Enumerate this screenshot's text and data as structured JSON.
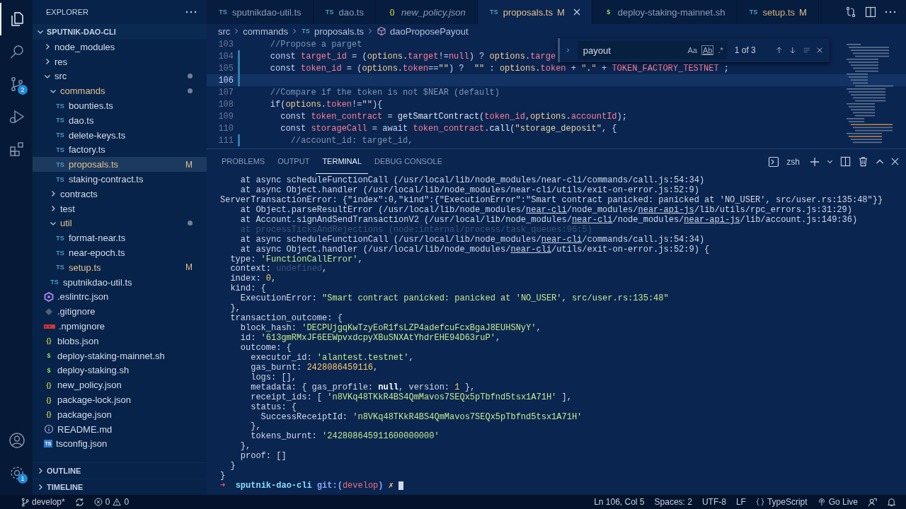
{
  "activity_bar": {
    "items": [
      {
        "kind": "explorer",
        "selected": true
      },
      {
        "kind": "search",
        "selected": false
      },
      {
        "kind": "source-control",
        "selected": false,
        "badge": "2"
      },
      {
        "kind": "run",
        "selected": false
      },
      {
        "kind": "extensions",
        "selected": false
      }
    ],
    "bottom": [
      {
        "kind": "account"
      },
      {
        "kind": "settings",
        "badge": "1"
      }
    ]
  },
  "sidebar": {
    "title": "EXPLORER",
    "root": {
      "label": "SPUTNIK-DAO-CLI",
      "expanded": true
    },
    "items": [
      {
        "label": "node_modules",
        "kind": "folder",
        "expanded": false,
        "has_changes": false,
        "modified": false
      },
      {
        "label": "res",
        "kind": "folder",
        "expanded": false,
        "has_changes": false,
        "modified": false
      },
      {
        "label": "src",
        "kind": "folder",
        "expanded": true,
        "has_changes": true,
        "modified": false,
        "children": [
          {
            "label": "commands",
            "kind": "folder",
            "expanded": true,
            "has_changes": true,
            "modified": true,
            "children": [
              {
                "label": "bounties.ts",
                "kind": "ts",
                "icon_text": "TS",
                "selected": false,
                "modified": false
              },
              {
                "label": "dao.ts",
                "kind": "ts",
                "icon_text": "TS",
                "selected": false,
                "modified": false
              },
              {
                "label": "delete-keys.ts",
                "kind": "ts",
                "icon_text": "TS",
                "selected": false,
                "modified": false
              },
              {
                "label": "factory.ts",
                "kind": "ts",
                "icon_text": "TS",
                "selected": false,
                "modified": false
              },
              {
                "label": "proposals.ts",
                "kind": "ts",
                "icon_text": "TS",
                "selected": true,
                "modified": true,
                "status": "M"
              },
              {
                "label": "staking-contract.ts",
                "kind": "ts",
                "icon_text": "TS",
                "selected": false,
                "modified": false
              }
            ]
          },
          {
            "label": "contracts",
            "kind": "folder",
            "expanded": false,
            "has_changes": false,
            "modified": false
          },
          {
            "label": "test",
            "kind": "folder",
            "expanded": false,
            "has_changes": false,
            "modified": false
          },
          {
            "label": "util",
            "kind": "folder",
            "expanded": true,
            "has_changes": true,
            "modified": true,
            "children": [
              {
                "label": "format-near.ts",
                "kind": "ts",
                "icon_text": "TS",
                "selected": false,
                "modified": false
              },
              {
                "label": "near-epoch.ts",
                "kind": "ts",
                "icon_text": "TS",
                "selected": false,
                "modified": false
              },
              {
                "label": "setup.ts",
                "kind": "ts",
                "icon_text": "TS",
                "selected": false,
                "modified": true,
                "status": "M"
              }
            ]
          },
          {
            "label": "sputnikdao-util.ts",
            "kind": "ts",
            "icon_text": "TS",
            "selected": false,
            "modified": false
          }
        ]
      },
      {
        "label": ".eslintrc.json",
        "kind": "eslint",
        "selected": false,
        "modified": false
      },
      {
        "label": ".gitignore",
        "kind": "git",
        "selected": false,
        "modified": false
      },
      {
        "label": ".npmignore",
        "kind": "npm",
        "selected": false,
        "modified": false
      },
      {
        "label": "blobs.json",
        "kind": "json",
        "icon_text": "{}",
        "selected": false,
        "modified": false
      },
      {
        "label": "deploy-staking-mainnet.sh",
        "kind": "sh",
        "icon_text": "$",
        "selected": false,
        "modified": false
      },
      {
        "label": "deploy-staking.sh",
        "kind": "sh",
        "icon_text": "$",
        "selected": false,
        "modified": false
      },
      {
        "label": "new_policy.json",
        "kind": "json",
        "icon_text": "{}",
        "selected": false,
        "modified": false
      },
      {
        "label": "package-lock.json",
        "kind": "json",
        "icon_text": "{}",
        "selected": false,
        "modified": false
      },
      {
        "label": "package.json",
        "kind": "json",
        "icon_text": "{}",
        "selected": false,
        "modified": false
      },
      {
        "label": "README.md",
        "kind": "info",
        "selected": false,
        "modified": false
      },
      {
        "label": "tsconfig.json",
        "kind": "tsconfig",
        "icon_text": "TS",
        "selected": false,
        "modified": false
      }
    ],
    "sections": [
      {
        "label": "OUTLINE",
        "expanded": false
      },
      {
        "label": "TIMELINE",
        "expanded": false
      }
    ]
  },
  "tabs": [
    {
      "label": "sputnikdao-util.ts",
      "kind": "ts",
      "icon_text": "TS",
      "selected": false,
      "preview": false,
      "modified": false
    },
    {
      "label": "dao.ts",
      "kind": "ts",
      "icon_text": "TS",
      "selected": false,
      "preview": false,
      "modified": false
    },
    {
      "label": "new_policy.json",
      "kind": "json",
      "icon_text": "{}",
      "selected": false,
      "preview": true,
      "modified": false
    },
    {
      "label": "proposals.ts",
      "kind": "ts",
      "icon_text": "TS",
      "selected": true,
      "preview": false,
      "modified": true,
      "status": "M"
    },
    {
      "label": "deploy-staking-mainnet.sh",
      "kind": "sh",
      "icon_text": "$",
      "selected": false,
      "preview": false,
      "modified": false
    },
    {
      "label": "setup.ts",
      "kind": "ts",
      "icon_text": "TS",
      "selected": false,
      "preview": false,
      "modified": true,
      "status": "M"
    }
  ],
  "breadcrumbs": [
    {
      "label": "src",
      "kind": "folder"
    },
    {
      "label": "commands",
      "kind": "folder"
    },
    {
      "label": "proposals.ts",
      "kind": "ts",
      "icon_text": "TS"
    },
    {
      "label": "daoProposePayout",
      "kind": "symbol"
    }
  ],
  "editor": {
    "lines": [
      {
        "num": "103",
        "changed": false,
        "current": false,
        "segments": [
          {
            "kind": "cmt",
            "text": "    //Propose a parget"
          }
        ]
      },
      {
        "num": "104",
        "changed": true,
        "current": false,
        "segments": [
          {
            "kind": "kw",
            "text": "    const "
          },
          {
            "kind": "id",
            "text": "target_id"
          },
          {
            "kind": "op",
            "text": " = ("
          },
          {
            "kind": "obj",
            "text": "options"
          },
          {
            "kind": "op",
            "text": "."
          },
          {
            "kind": "id",
            "text": "target"
          },
          {
            "kind": "op",
            "text": "!="
          },
          {
            "kind": "id",
            "text": "null"
          },
          {
            "kind": "op",
            "text": ") ? "
          },
          {
            "kind": "obj",
            "text": "options"
          },
          {
            "kind": "op",
            "text": "."
          },
          {
            "kind": "id",
            "text": "targe"
          }
        ]
      },
      {
        "num": "105",
        "changed": true,
        "current": false,
        "segments": [
          {
            "kind": "kw",
            "text": "    const "
          },
          {
            "kind": "id",
            "text": "token_id"
          },
          {
            "kind": "op",
            "text": " = ("
          },
          {
            "kind": "obj",
            "text": "options"
          },
          {
            "kind": "op",
            "text": "."
          },
          {
            "kind": "id",
            "text": "token"
          },
          {
            "kind": "op",
            "text": "=="
          },
          {
            "kind": "str",
            "text": "\"\""
          },
          {
            "kind": "op",
            "text": ") ?  "
          },
          {
            "kind": "str",
            "text": "\"\""
          },
          {
            "kind": "op",
            "text": " : "
          },
          {
            "kind": "obj",
            "text": "options"
          },
          {
            "kind": "op",
            "text": "."
          },
          {
            "kind": "id",
            "text": "token"
          },
          {
            "kind": "op",
            "text": " + "
          },
          {
            "kind": "str",
            "text": "\".\""
          },
          {
            "kind": "op",
            "text": " + "
          },
          {
            "kind": "id",
            "text": "TOKEN_FACTORY_TESTNET"
          },
          {
            "kind": "op",
            "text": " ;"
          }
        ]
      },
      {
        "num": "106",
        "changed": true,
        "current": true
      },
      {
        "num": "107",
        "changed": false,
        "current": false,
        "segments": [
          {
            "kind": "cmt",
            "text": "    //Compare if the token is not $NEAR (default)"
          }
        ]
      },
      {
        "num": "108",
        "changed": false,
        "current": false,
        "segments": [
          {
            "kind": "kw",
            "text": "    if"
          },
          {
            "kind": "op",
            "text": "("
          },
          {
            "kind": "obj",
            "text": "options"
          },
          {
            "kind": "op",
            "text": "."
          },
          {
            "kind": "id",
            "text": "token"
          },
          {
            "kind": "op",
            "text": "!="
          },
          {
            "kind": "str",
            "text": "\"\""
          },
          {
            "kind": "op",
            "text": "){"
          }
        ]
      },
      {
        "num": "109",
        "changed": false,
        "current": false,
        "segments": [
          {
            "kind": "kw",
            "text": "      const "
          },
          {
            "kind": "id",
            "text": "token_contract"
          },
          {
            "kind": "op",
            "text": " = "
          },
          {
            "kind": "fn",
            "text": "getSmartContract"
          },
          {
            "kind": "op",
            "text": "("
          },
          {
            "kind": "id",
            "text": "token_id"
          },
          {
            "kind": "op",
            "text": ","
          },
          {
            "kind": "obj",
            "text": "options"
          },
          {
            "kind": "op",
            "text": "."
          },
          {
            "kind": "id",
            "text": "accountId"
          },
          {
            "kind": "op",
            "text": ");"
          }
        ]
      },
      {
        "num": "110",
        "changed": false,
        "current": false,
        "segments": [
          {
            "kind": "kw",
            "text": "      const "
          },
          {
            "kind": "id",
            "text": "storageCall"
          },
          {
            "kind": "op",
            "text": " = "
          },
          {
            "kind": "kw",
            "text": "await "
          },
          {
            "kind": "id",
            "text": "token_contract"
          },
          {
            "kind": "op",
            "text": "."
          },
          {
            "kind": "fn",
            "text": "call"
          },
          {
            "kind": "op",
            "text": "("
          },
          {
            "kind": "str",
            "text": "\"storage_deposit\""
          },
          {
            "kind": "op",
            "text": ", {"
          }
        ]
      },
      {
        "num": "111",
        "changed": true,
        "current": false,
        "segments": [
          {
            "kind": "cmt",
            "text": "        //account_id: target_id,"
          }
        ]
      }
    ],
    "find": {
      "value": "payout",
      "options": [
        "Aa",
        "Ab",
        ".*"
      ],
      "result": "1 of 3"
    }
  },
  "panel": {
    "tabs": [
      {
        "label": "PROBLEMS",
        "selected": false
      },
      {
        "label": "OUTPUT",
        "selected": false
      },
      {
        "label": "TERMINAL",
        "selected": true
      },
      {
        "label": "DEBUG CONSOLE",
        "selected": false
      }
    ],
    "shell": "zsh",
    "cursor": true,
    "lines": [
      [
        {
          "kind": "p",
          "text": "    at async scheduleFunctionCall (/usr/local/lib/node_modules/near-cli/commands/call.js:54:34)"
        }
      ],
      [
        {
          "kind": "p",
          "text": "    at async Object.handler (/usr/local/lib/node_modules/near-cli/utils/exit-on-error.js:52:9)"
        }
      ],
      [
        {
          "kind": "p",
          "text": "ServerTransactionError: {\"index\":0,\"kind\":{\"ExecutionError\":\"Smart contract panicked: panicked at 'NO_USER', src/user.rs:135:48\"}}"
        }
      ],
      [
        {
          "kind": "p",
          "text": "    at Object.parseResultError (/usr/local/lib/node_modules/"
        },
        {
          "kind": "link",
          "text": "near-cli"
        },
        {
          "kind": "p",
          "text": "/node_modules/"
        },
        {
          "kind": "link",
          "text": "near-api-js"
        },
        {
          "kind": "p",
          "text": "/lib/utils/rpc_errors.js:31:29)"
        }
      ],
      [
        {
          "kind": "p",
          "text": "    at Account.signAndSendTransactionV2 (/usr/local/lib/node_modules/"
        },
        {
          "kind": "link",
          "text": "near-cli"
        },
        {
          "kind": "p",
          "text": "/node_modules/"
        },
        {
          "kind": "link",
          "text": "near-api-js"
        },
        {
          "kind": "p",
          "text": "/lib/account.js:149:36)"
        }
      ],
      [
        {
          "kind": "dim",
          "text": "    at processTicksAndRejections (node:internal/process/task_queues:96:5)"
        }
      ],
      [
        {
          "kind": "p",
          "text": "    at async scheduleFunctionCall (/usr/local/lib/node_modules/"
        },
        {
          "kind": "link",
          "text": "near-cli"
        },
        {
          "kind": "p",
          "text": "/commands/call.js:54:34)"
        }
      ],
      [
        {
          "kind": "p",
          "text": "    at async Object.handler (/usr/local/lib/node_modules/"
        },
        {
          "kind": "link",
          "text": "near-cli"
        },
        {
          "kind": "p",
          "text": "/utils/exit-on-error.js:52:9) {"
        }
      ],
      [
        {
          "kind": "p",
          "text": "  type: "
        },
        {
          "kind": "str",
          "text": "'FunctionCallError'"
        },
        {
          "kind": "p",
          "text": ","
        }
      ],
      [
        {
          "kind": "p",
          "text": "  context: "
        },
        {
          "kind": "dim",
          "text": "undefined"
        },
        {
          "kind": "p",
          "text": ","
        }
      ],
      [
        {
          "kind": "p",
          "text": "  index: "
        },
        {
          "kind": "num",
          "text": "0"
        },
        {
          "kind": "p",
          "text": ","
        }
      ],
      [
        {
          "kind": "p",
          "text": "  kind: {"
        }
      ],
      [
        {
          "kind": "p",
          "text": "    ExecutionError: "
        },
        {
          "kind": "str",
          "text": "\"Smart contract panicked: panicked at 'NO_USER', src/user.rs:135:48\""
        }
      ],
      [
        {
          "kind": "p",
          "text": "  },"
        }
      ],
      [
        {
          "kind": "p",
          "text": "  transaction_outcome: {"
        }
      ],
      [
        {
          "kind": "p",
          "text": "    block_hash: "
        },
        {
          "kind": "str",
          "text": "'DECPUjgqKwTzyEoR1fsLZP4adefcuFcxBgaJ8EUHSNyY'"
        },
        {
          "kind": "p",
          "text": ","
        }
      ],
      [
        {
          "kind": "p",
          "text": "    id: "
        },
        {
          "kind": "str",
          "text": "'613gmRMxJF6EEWpvxdcpyXBuSNXAtYhdrEHE94D63ruP'"
        },
        {
          "kind": "p",
          "text": ","
        }
      ],
      [
        {
          "kind": "p",
          "text": "    outcome: {"
        }
      ],
      [
        {
          "kind": "p",
          "text": "      executor_id: "
        },
        {
          "kind": "str",
          "text": "'alantest.testnet'"
        },
        {
          "kind": "p",
          "text": ","
        }
      ],
      [
        {
          "kind": "p",
          "text": "      gas_burnt: "
        },
        {
          "kind": "num",
          "text": "2428086459116"
        },
        {
          "kind": "p",
          "text": ","
        }
      ],
      [
        {
          "kind": "p",
          "text": "      logs: [],"
        }
      ],
      [
        {
          "kind": "p",
          "text": "      metadata: { gas_profile: "
        },
        {
          "kind": "bold",
          "text": "null"
        },
        {
          "kind": "p",
          "text": ", version: "
        },
        {
          "kind": "num",
          "text": "1"
        },
        {
          "kind": "p",
          "text": " },"
        }
      ],
      [
        {
          "kind": "p",
          "text": "      receipt_ids: [ "
        },
        {
          "kind": "str",
          "text": "'n8VKq48TKkR4BS4QmMavos7SEQx5pTbfnd5tsx1A71H'"
        },
        {
          "kind": "p",
          "text": " ],"
        }
      ],
      [
        {
          "kind": "p",
          "text": "      status: {"
        }
      ],
      [
        {
          "kind": "p",
          "text": "        SuccessReceiptId: "
        },
        {
          "kind": "str",
          "text": "'n8VKq48TKkR4BS4QmMavos7SEQx5pTbfnd5tsx1A71H'"
        }
      ],
      [
        {
          "kind": "p",
          "text": "      },"
        }
      ],
      [
        {
          "kind": "p",
          "text": "      tokens_burnt: "
        },
        {
          "kind": "str",
          "text": "'242808645911600000000'"
        }
      ],
      [
        {
          "kind": "p",
          "text": "    },"
        }
      ],
      [
        {
          "kind": "p",
          "text": "    proof: []"
        }
      ],
      [
        {
          "kind": "p",
          "text": "  }"
        }
      ],
      [
        {
          "kind": "p",
          "text": "}"
        }
      ],
      [
        {
          "kind": "arrow",
          "text": "➜  "
        },
        {
          "kind": "dir",
          "text": "sputnik-dao-cli "
        },
        {
          "kind": "git",
          "text": "git:("
        },
        {
          "kind": "branch",
          "text": "develop"
        },
        {
          "kind": "git",
          "text": ") "
        },
        {
          "kind": "dirty",
          "text": "✗"
        }
      ]
    ]
  },
  "status_bar": {
    "left": [
      {
        "kind": "branch",
        "text": "develop*"
      },
      {
        "kind": "sync"
      },
      {
        "kind": "problems",
        "errors": "0",
        "warnings": "0"
      }
    ],
    "right": [
      {
        "kind": "text",
        "text": "Ln 106, Col 5"
      },
      {
        "kind": "text",
        "text": "Spaces: 2"
      },
      {
        "kind": "text",
        "text": "UTF-8"
      },
      {
        "kind": "text",
        "text": "LF"
      },
      {
        "kind": "language",
        "text": "TypeScript"
      },
      {
        "kind": "live",
        "text": "Go Live"
      },
      {
        "kind": "feedback"
      },
      {
        "kind": "bell"
      }
    ]
  }
}
